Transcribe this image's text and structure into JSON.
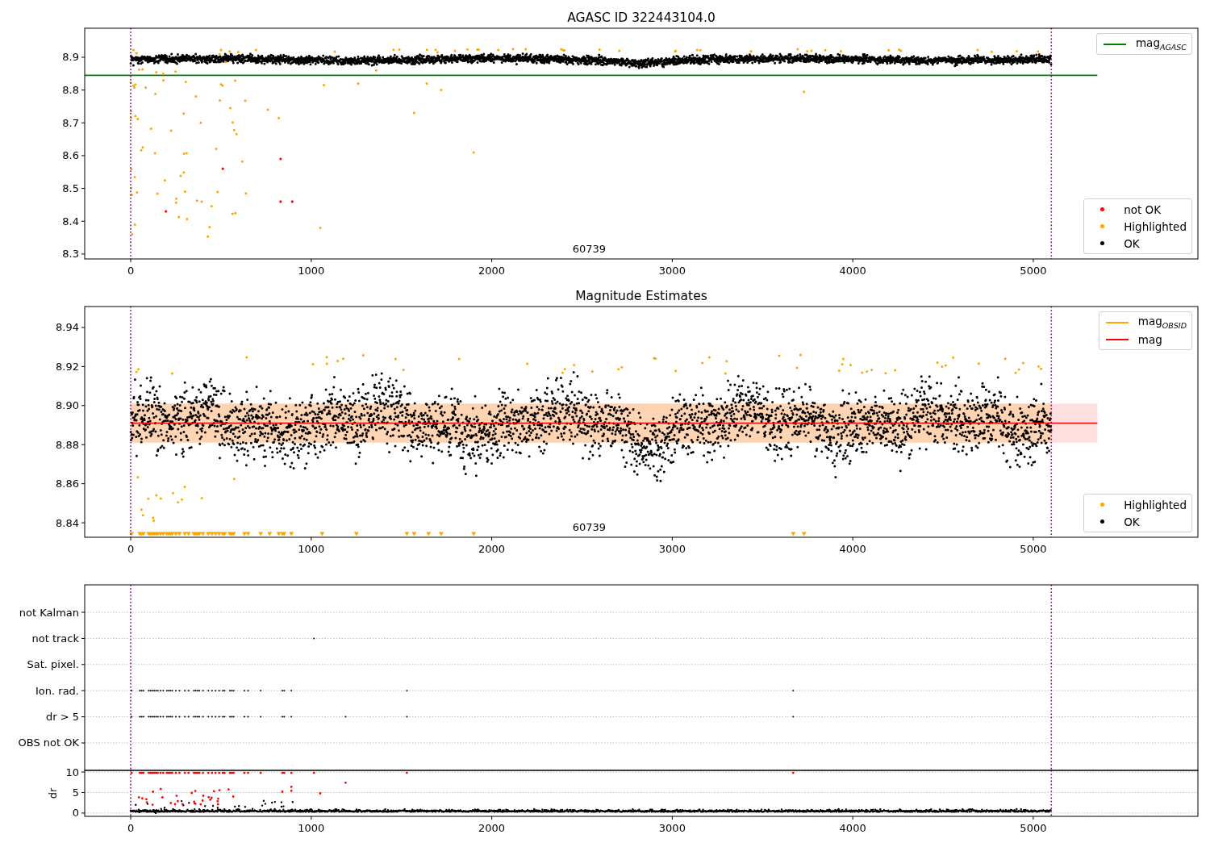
{
  "figure": {
    "panels": [
      {
        "kind": "agasc",
        "title": "AGASC ID 322443104.0",
        "x_tick_labels": [
          "0",
          "1000",
          "2000",
          "3000",
          "4000",
          "5000"
        ],
        "y_tick_labels": [
          "8.9",
          "8.8",
          "8.7",
          "8.6",
          "8.5",
          "8.4",
          "8.3"
        ],
        "annotation": "60739",
        "line_legend": [
          {
            "label": "mag$_{AGASC}$",
            "color": "#008000"
          }
        ],
        "point_legend": [
          {
            "label": "not OK",
            "color": "#ff0000"
          },
          {
            "label": "Highlighted",
            "color": "#ffa500"
          },
          {
            "label": "OK",
            "color": "#000000"
          }
        ]
      },
      {
        "kind": "estimates",
        "title": "Magnitude Estimates",
        "x_tick_labels": [
          "0",
          "1000",
          "2000",
          "3000",
          "4000",
          "5000"
        ],
        "y_tick_labels": [
          "8.94",
          "8.92",
          "8.90",
          "8.88",
          "8.86",
          "8.84"
        ],
        "annotation": "60739",
        "line_legend": [
          {
            "label": "mag$_{OBSID}$",
            "color": "#ffa500"
          },
          {
            "label": "mag",
            "color": "#ff0000"
          }
        ],
        "point_legend": [
          {
            "label": "Highlighted",
            "color": "#ffa500"
          },
          {
            "label": "OK",
            "color": "#000000"
          }
        ]
      },
      {
        "kind": "flags",
        "y_tick_labels": [
          "not Kalman",
          "not track",
          "Sat. pixel.",
          "Ion. rad.",
          "dr > 5",
          "OBS not OK"
        ]
      },
      {
        "kind": "dr",
        "y_label": "dr",
        "x_tick_labels": [
          "0",
          "1000",
          "2000",
          "3000",
          "4000",
          "5000"
        ],
        "y_tick_labels": [
          "10",
          "5",
          "0"
        ]
      }
    ]
  }
}
